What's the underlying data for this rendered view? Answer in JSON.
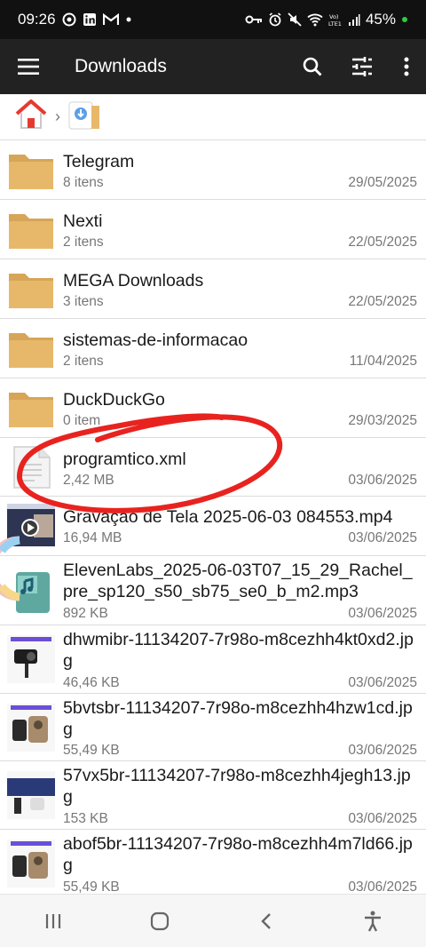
{
  "status": {
    "time": "09:26",
    "battery": "45%"
  },
  "appbar": {
    "title": "Downloads"
  },
  "files": [
    {
      "name": "Telegram",
      "meta": "8 itens",
      "date": "29/05/2025",
      "type": "folder"
    },
    {
      "name": "Nexti",
      "meta": "2 itens",
      "date": "22/05/2025",
      "type": "folder"
    },
    {
      "name": "MEGA Downloads",
      "meta": "3 itens",
      "date": "22/05/2025",
      "type": "folder"
    },
    {
      "name": "sistemas-de-informacao",
      "meta": "2 itens",
      "date": "11/04/2025",
      "type": "folder"
    },
    {
      "name": "DuckDuckGo",
      "meta": "0 item",
      "date": "29/03/2025",
      "type": "folder"
    },
    {
      "name": "programtico.xml",
      "meta": "2,42 MB",
      "date": "03/06/2025",
      "type": "doc"
    },
    {
      "name": "Gravação de Tela 2025-06-03 084553.mp4",
      "meta": "16,94 MB",
      "date": "03/06/2025",
      "type": "video"
    },
    {
      "name": "ElevenLabs_2025-06-03T07_15_29_Rachel_pre_sp120_s50_sb75_se0_b_m2.mp3",
      "meta": "892 KB",
      "date": "03/06/2025",
      "type": "audio"
    },
    {
      "name": "dhwmibr-11134207-7r98o-m8cezhh4kt0xd2.jpg",
      "meta": "46,46 KB",
      "date": "03/06/2025",
      "type": "image"
    },
    {
      "name": "5bvtsbr-11134207-7r98o-m8cezhh4hzw1cd.jpg",
      "meta": "55,49 KB",
      "date": "03/06/2025",
      "type": "image"
    },
    {
      "name": "57vx5br-11134207-7r98o-m8cezhh4jegh13.jpg",
      "meta": "153 KB",
      "date": "03/06/2025",
      "type": "image"
    },
    {
      "name": "abof5br-11134207-7r98o-m8cezhh4m7ld66.jpg",
      "meta": "55,49 KB",
      "date": "03/06/2025",
      "type": "image"
    }
  ],
  "colors": {
    "appbar": "#222222",
    "folder": "#e8b86a",
    "folder_dark": "#d7a557",
    "annotation": "#e8231f"
  }
}
